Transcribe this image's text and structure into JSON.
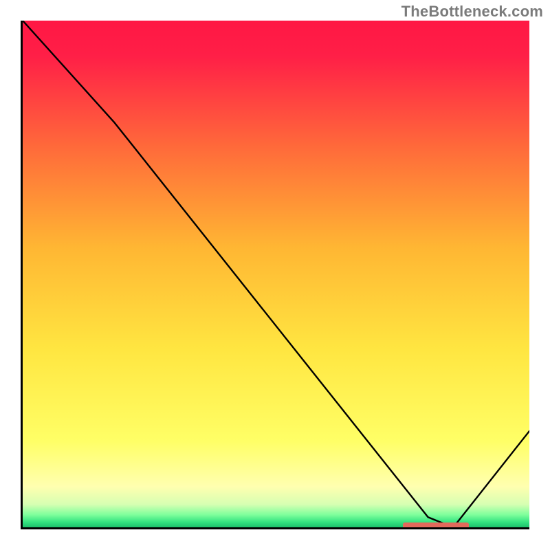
{
  "watermark": "TheBottleneck.com",
  "chart_data": {
    "type": "line",
    "title": "",
    "xlabel": "",
    "ylabel": "",
    "xlim": [
      0,
      100
    ],
    "ylim": [
      0,
      100
    ],
    "x": [
      0,
      18,
      22,
      80,
      85,
      100
    ],
    "values": [
      100,
      80,
      75,
      2,
      0,
      19
    ],
    "background": {
      "type": "vertical-gradient",
      "stops": [
        {
          "pos": 0.0,
          "color": "#ff1744"
        },
        {
          "pos": 0.07,
          "color": "#ff1f47"
        },
        {
          "pos": 0.25,
          "color": "#ff6a3a"
        },
        {
          "pos": 0.45,
          "color": "#ffb733"
        },
        {
          "pos": 0.65,
          "color": "#ffe641"
        },
        {
          "pos": 0.83,
          "color": "#ffff66"
        },
        {
          "pos": 0.92,
          "color": "#ffffb0"
        },
        {
          "pos": 0.955,
          "color": "#d6ffb2"
        },
        {
          "pos": 0.975,
          "color": "#7fff9c"
        },
        {
          "pos": 0.99,
          "color": "#32e27f"
        },
        {
          "pos": 1.0,
          "color": "#1ec06c"
        }
      ]
    },
    "marker": {
      "x_start": 75,
      "x_end": 88,
      "y": 0,
      "color": "#e2695b"
    }
  }
}
